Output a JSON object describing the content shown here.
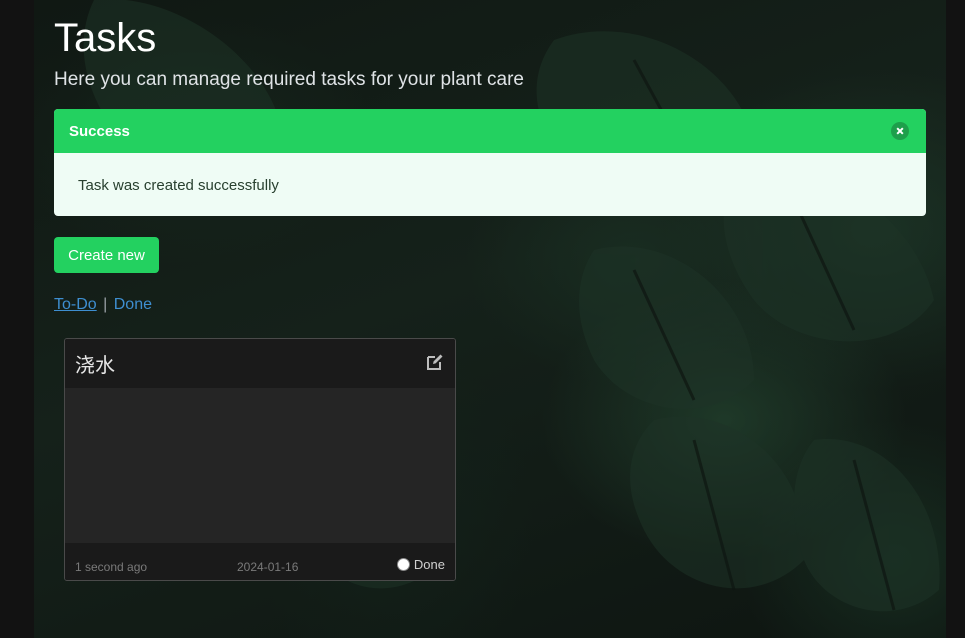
{
  "page": {
    "title": "Tasks",
    "subtitle": "Here you can manage required tasks for your plant care"
  },
  "alert": {
    "title": "Success",
    "message": "Task was created successfully",
    "color": "#23d160"
  },
  "actions": {
    "create_label": "Create new"
  },
  "filters": {
    "todo_label": "To-Do",
    "separator": "|",
    "done_label": "Done"
  },
  "tasks": [
    {
      "title": "浇水",
      "created_ago": "1 second ago",
      "due_date": "2024-01-16",
      "done_label": "Done",
      "done": false
    }
  ],
  "icons": {
    "edit": "edit-icon",
    "close": "close-icon"
  }
}
